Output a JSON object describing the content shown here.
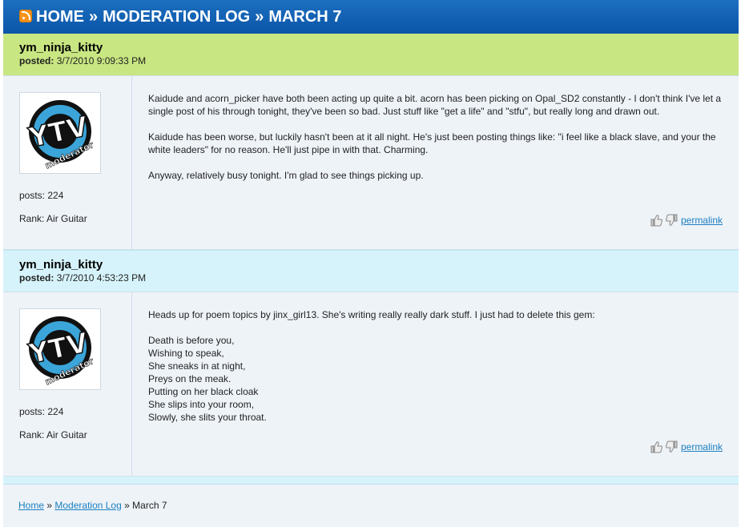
{
  "header": {
    "home": "HOME",
    "separator": "»",
    "section": "MODERATION LOG",
    "current": "MARCH 7"
  },
  "posts": [
    {
      "author": "ym_ninja_kitty",
      "posted_label": "posted:",
      "posted_value": "3/7/2010 9:09:33 PM",
      "posts_stat": "posts: 224",
      "rank_stat": "Rank: Air Guitar",
      "paragraphs": [
        "Kaidude and acorn_picker have both been acting up quite a bit. acorn has been picking on Opal_SD2 constantly - I don't think I've let a single post of his through tonight, they've been so bad. Just stuff like \"get a life\" and \"stfu\", but really long and drawn out.",
        "Kaidude has been worse, but luckily hasn't been at it all night. He's just been posting things like: \"i feel like a black slave, and your the white leaders\" for no reason. He'll just pipe in with that. Charming.",
        "Anyway, relatively busy tonight. I'm glad to see things picking up."
      ],
      "permalink": "permalink"
    },
    {
      "author": "ym_ninja_kitty",
      "posted_label": "posted:",
      "posted_value": "3/7/2010 4:53:23 PM",
      "posts_stat": "posts: 224",
      "rank_stat": "Rank: Air Guitar",
      "intro": "Heads up for poem topics by jinx_girl13. She's writing really really dark stuff. I just had to delete this gem:",
      "poem": [
        "Death is before you,",
        "Wishing to speak,",
        "She sneaks in at night,",
        "Preys on the meak.",
        "Putting on her black cloak",
        "She slips into your room,",
        "Slowly, she slits your throat."
      ],
      "permalink": "permalink"
    }
  ],
  "avatar": {
    "logo_letters": "YTV",
    "logo_sub": "moderator"
  },
  "breadcrumb": {
    "home": "Home",
    "separator": "»",
    "section": "Moderation Log",
    "current": "March 7"
  },
  "colors": {
    "header": "#0a55a8",
    "post1_head": "#c8e682",
    "post2_head": "#d6f3fb",
    "body_bg": "#eef3f8",
    "link": "#1c7fc0"
  },
  "icons": [
    "rss-icon",
    "thumbs-up-icon",
    "thumbs-down-icon"
  ]
}
